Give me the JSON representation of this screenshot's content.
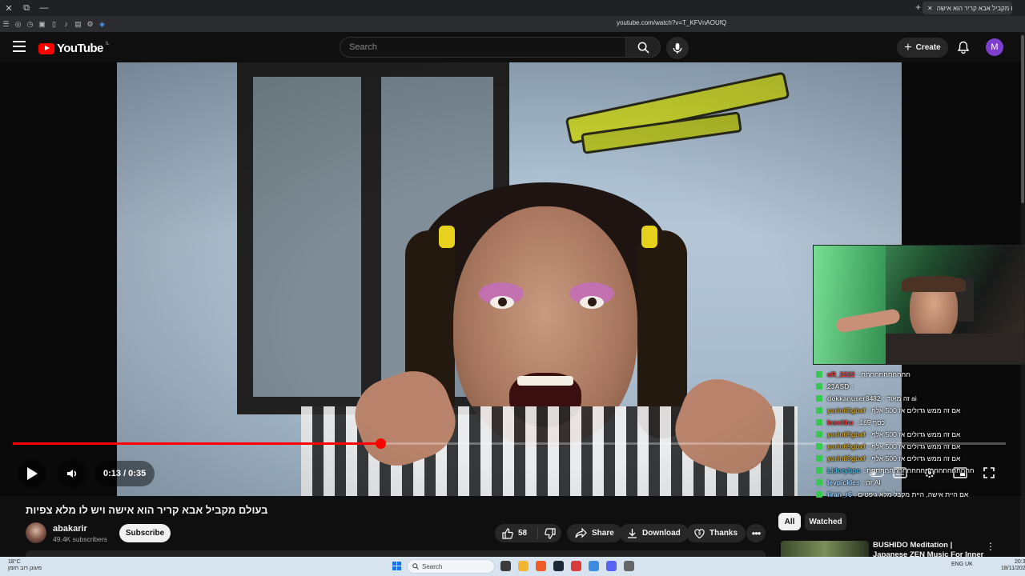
{
  "browser": {
    "tab_title": "בעולם מקביל אבא קריר הוא אישה",
    "url": "youtube.com/watch?v=T_KFVnAOUfQ"
  },
  "header": {
    "logo_text": "YouTube",
    "logo_country": "IL",
    "search_placeholder": "Search",
    "create_label": "Create",
    "avatar_letter": "M"
  },
  "player": {
    "time_display": "0:13 / 0:35",
    "progress": 0.37
  },
  "chat": [
    {
      "user": "eR_2222",
      "color": "#e04040",
      "msg": ": חחחחחחחחחחח"
    },
    {
      "user": "23ASD",
      "color": "#e0e0e0",
      "msg": ":"
    },
    {
      "user": "dokkanuser8482",
      "color": "#e0e0e0",
      "msg": ": זה מאוד ai"
    },
    {
      "user": "yarin69gbxf",
      "color": "#c9a227",
      "msg": ": אם זה ממש גדולים אז 500 אלף"
    },
    {
      "user": "Inexitbu",
      "color": "#e04040",
      "msg": ": כסף 169"
    },
    {
      "user": "yarin69gbxf",
      "color": "#c9a227",
      "msg": ": אם זה ממש גדולים אז 500 אלף"
    },
    {
      "user": "yarin69gbxf",
      "color": "#c9a227",
      "msg": ": אם זה ממש גדולים אז 500 אלף"
    },
    {
      "user": "yarin69gbxf",
      "color": "#c9a227",
      "msg": ": אם זה ממש גדולים אז 500 אלף"
    },
    {
      "user": "Lidorybpo",
      "color": "#3fb8e0",
      "msg": ": חחחחחחחחחחחחחחחחחחחחחחחח"
    },
    {
      "user": "levpickles",
      "color": "#9fd3ff",
      "msg": ": זה AI"
    },
    {
      "user": "liran_r6",
      "color": "#9fd3ff",
      "msg": ": אם היית אישה, היית מקבל מלא גיפטים"
    }
  ],
  "video": {
    "title": "בעולם מקביל אבא קריר הוא אישה ויש לו מלא צפיות",
    "channel_name": "abakarir",
    "subscribers": "49.4K subscribers",
    "subscribe_label": "Subscribe",
    "likes": "58",
    "share_label": "Share",
    "download_label": "Download",
    "thanks_label": "Thanks"
  },
  "sidebar": {
    "chip_all": "All",
    "chip_watched": "Watched",
    "rec_title": "BUSHIDO Meditation | Japanese ZEN Music For Inner Healing"
  },
  "taskbar": {
    "weather_line1": "18°C",
    "weather_line2": "מעונן רוב הזמן",
    "search_label": "Search",
    "lang": "ENG UK",
    "time": "20:38",
    "date": "18/11/2025"
  },
  "colors": {
    "accent_red": "#ff0000",
    "bg": "#0f0f0f",
    "chip_bg": "#272727"
  }
}
